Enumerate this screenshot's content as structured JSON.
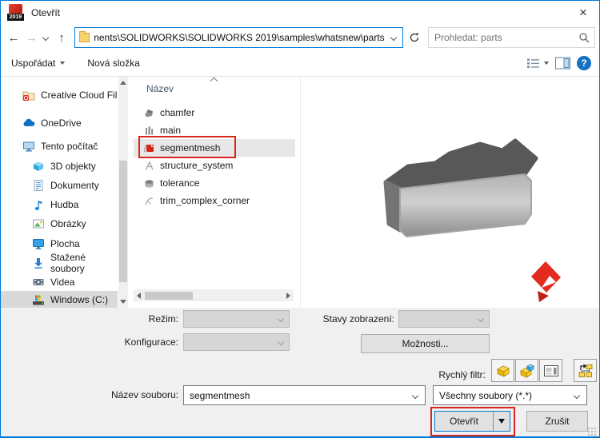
{
  "window": {
    "title": "Otevřít",
    "icon_year": "2019",
    "close_glyph": "×"
  },
  "nav": {
    "back_glyph": "←",
    "forward_glyph": "→",
    "up_glyph": "↑",
    "address_path": "nents\\SOLIDWORKS\\SOLIDWORKS 2019\\samples\\whatsnew\\parts",
    "search_placeholder": "Prohledat: parts"
  },
  "toolbar": {
    "organize_label": "Uspořádat",
    "new_folder_label": "Nová složka",
    "help_glyph": "?"
  },
  "sidebar": {
    "items": [
      {
        "label": "Creative Cloud Fil"
      },
      {
        "label": "OneDrive"
      },
      {
        "label": "Tento počítač"
      },
      {
        "label": "3D objekty"
      },
      {
        "label": "Dokumenty"
      },
      {
        "label": "Hudba"
      },
      {
        "label": "Obrázky"
      },
      {
        "label": "Plocha"
      },
      {
        "label": "Stažené soubory"
      },
      {
        "label": "Videa"
      },
      {
        "label": "Windows (C:)"
      }
    ]
  },
  "filelist": {
    "header": "Název",
    "files": [
      {
        "name": "chamfer"
      },
      {
        "name": "main"
      },
      {
        "name": "segmentmesh"
      },
      {
        "name": "structure_system"
      },
      {
        "name": "tolerance"
      },
      {
        "name": "trim_complex_corner"
      }
    ],
    "selected": "segmentmesh"
  },
  "details": {
    "mode_label": "Režim:",
    "display_states_label": "Stavy zobrazení:",
    "configuration_label": "Konfigurace:",
    "options_button": "Možnosti..."
  },
  "quick_filter": {
    "label": "Rychlý filtr:"
  },
  "file_row": {
    "filename_label": "Název souboru:",
    "filename_value": "segmentmesh",
    "filetype_value": "Všechny soubory (*.*)"
  },
  "action_buttons": {
    "open": "Otevřít",
    "cancel": "Zrušit"
  },
  "colors": {
    "accent_blue": "#0078d7",
    "annotation_red": "#da251c"
  }
}
